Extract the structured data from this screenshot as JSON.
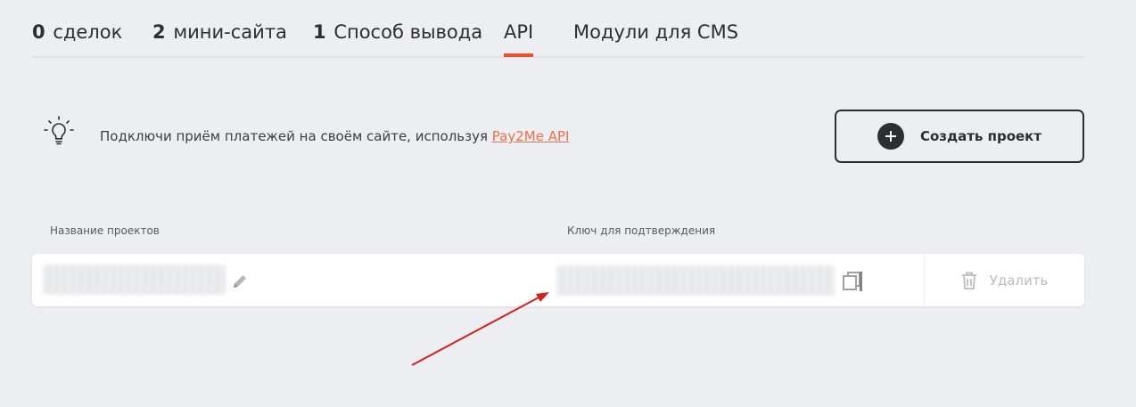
{
  "tabs": [
    {
      "count": "0",
      "label": "сделок"
    },
    {
      "count": "2",
      "label": "мини-сайта"
    },
    {
      "count": "1",
      "label": "Способ вывода"
    },
    {
      "count": "",
      "label": "API"
    },
    {
      "count": "",
      "label": "Модули для CMS"
    }
  ],
  "active_tab": "API",
  "info": {
    "text": "Подключи приём платежей на своём сайте, используя ",
    "link": "Pay2Me API",
    "icon": "lightbulb-icon"
  },
  "create_button": {
    "label": "Создать проект",
    "icon": "plus-circle-icon"
  },
  "table": {
    "columns": [
      "Название проектов",
      "Ключ для подтверждения"
    ],
    "rows": [
      {
        "name": "",
        "key": "",
        "delete_label": "Удалить"
      }
    ]
  },
  "colors": {
    "accent": "#f04e23",
    "link": "#f07048",
    "background": "#eceef1",
    "annotation_arrow": "#d0221a"
  }
}
